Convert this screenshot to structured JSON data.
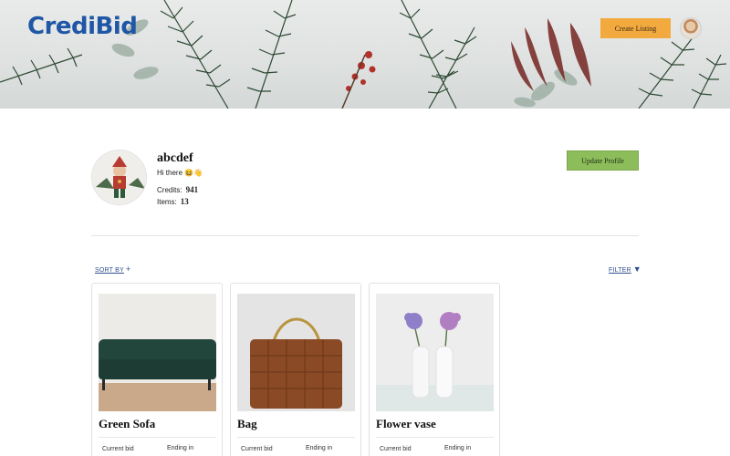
{
  "header": {
    "logo": "CrediBid",
    "create_listing_label": "Create Listing"
  },
  "profile": {
    "username": "abcdef",
    "bio": "Hi there 😆👋",
    "credits_label": "Credits:",
    "credits_value": "941",
    "items_label": "Items:",
    "items_value": "13",
    "update_label": "Update Profile"
  },
  "controls": {
    "sort_label": "SORT BY",
    "sort_icon": "plus-icon",
    "filter_label": "FILTER",
    "filter_icon": "funnel-icon"
  },
  "listings": [
    {
      "title": "Green Sofa",
      "current_bid_label": "Current bid",
      "ending_label": "Ending in"
    },
    {
      "title": "Bag",
      "current_bid_label": "Current bid",
      "ending_label": "Ending in"
    },
    {
      "title": "Flower vase",
      "current_bid_label": "Current bid",
      "ending_label": "Ending in"
    }
  ],
  "colors": {
    "brand": "#1f56a6",
    "create_button": "#f2a93e",
    "update_button": "#8dbd5b",
    "link": "#2f4f8f"
  }
}
